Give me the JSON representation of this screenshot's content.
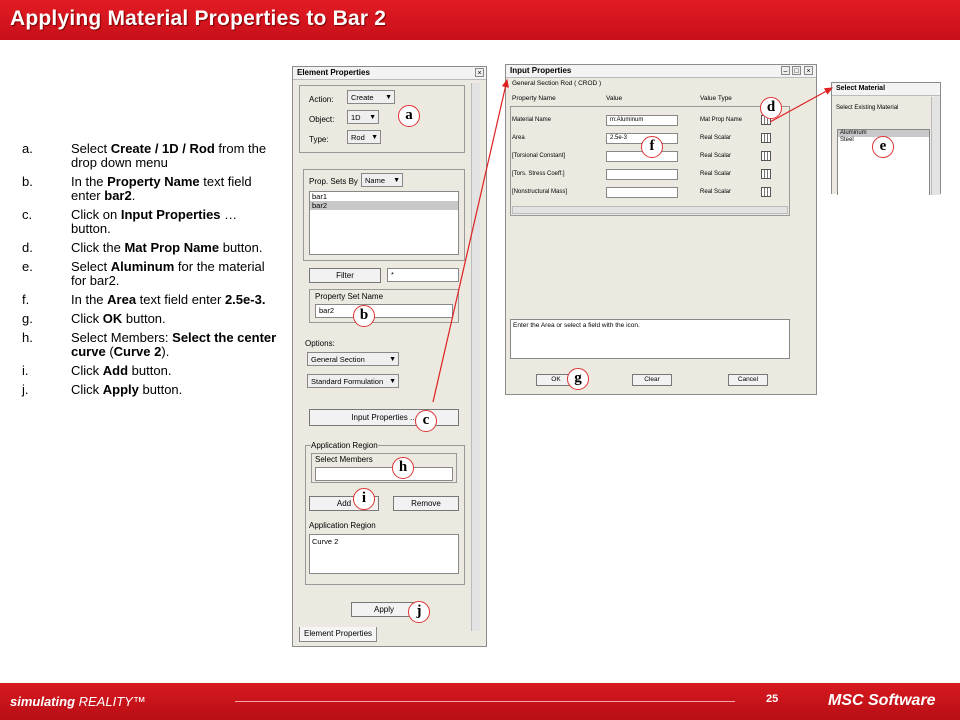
{
  "header": {
    "title": "Applying Material Properties to Bar 2"
  },
  "steps": [
    {
      "letter": "a.",
      "parts": [
        [
          "Select ",
          false
        ],
        [
          "Create / 1D / Rod",
          true
        ],
        [
          " from the drop down menu",
          false
        ]
      ]
    },
    {
      "letter": "b.",
      "parts": [
        [
          "In the ",
          false
        ],
        [
          "Property Name",
          true
        ],
        [
          " text field enter ",
          false
        ],
        [
          "bar2",
          true
        ],
        [
          ".",
          false
        ]
      ]
    },
    {
      "letter": "c.",
      "parts": [
        [
          "Click on ",
          false
        ],
        [
          "Input Properties",
          true
        ],
        [
          " … button.",
          false
        ]
      ]
    },
    {
      "letter": "d.",
      "parts": [
        [
          "Click the ",
          false
        ],
        [
          "Mat Prop Name",
          true
        ],
        [
          " button.",
          false
        ]
      ]
    },
    {
      "letter": "e.",
      "parts": [
        [
          "Select ",
          false
        ],
        [
          "Aluminum",
          true
        ],
        [
          " for the material for bar2.",
          false
        ]
      ]
    },
    {
      "letter": "f.",
      "parts": [
        [
          "In the ",
          false
        ],
        [
          "Area",
          true
        ],
        [
          " text field enter ",
          false
        ],
        [
          "2.5e-3.",
          true
        ]
      ]
    },
    {
      "letter": "g.",
      "parts": [
        [
          "Click ",
          false
        ],
        [
          "OK",
          true
        ],
        [
          " button.",
          false
        ]
      ]
    },
    {
      "letter": "h.",
      "parts": [
        [
          "Select Members: ",
          false
        ],
        [
          "Select the center curve",
          true
        ],
        [
          " (",
          false
        ],
        [
          "Curve 2",
          true
        ],
        [
          ").",
          false
        ]
      ]
    },
    {
      "letter": "i.",
      "parts": [
        [
          "Click ",
          false
        ],
        [
          "Add",
          true
        ],
        [
          " button.",
          false
        ]
      ]
    },
    {
      "letter": "j.",
      "parts": [
        [
          "Click ",
          false
        ],
        [
          "Apply",
          true
        ],
        [
          " button.",
          false
        ]
      ]
    }
  ],
  "element_properties": {
    "title": "Element Properties",
    "action_label": "Action:",
    "action_value": "Create",
    "object_label": "Object:",
    "object_value": "1D",
    "type_label": "Type:",
    "type_value": "Rod",
    "prop_sets_by_label": "Prop. Sets By",
    "prop_sets_by_value": "Name",
    "prop_sets": [
      "bar1",
      "bar2"
    ],
    "filter_button": "Filter",
    "filter_value": "*",
    "property_set_name_label": "Property Set Name",
    "property_set_name_value": "bar2",
    "options_label": "Options:",
    "option1": "General Section",
    "option2": "Standard Formulation",
    "input_properties_button": "Input Properties ...",
    "application_region_label": "Application Region",
    "select_members_label": "Select Members",
    "add_button": "Add",
    "remove_button": "Remove",
    "application_region_list_label": "Application Region",
    "application_region_items": [
      "Curve 2"
    ],
    "apply_button": "Apply",
    "tab_label": "Element Properties"
  },
  "input_properties": {
    "title": "Input Properties",
    "subtitle": "General Section Rod ( CROD )",
    "col_name": "Property Name",
    "col_value": "Value",
    "col_type": "Value Type",
    "rows": [
      {
        "name": "Material Name",
        "value": "m:Aluminum",
        "type": "Mat Prop Name"
      },
      {
        "name": "Area",
        "value": "2.5e-3",
        "type": "Real Scalar"
      },
      {
        "name": "[Torsional Constant]",
        "value": "",
        "type": "Real Scalar"
      },
      {
        "name": "[Tors. Stress Coeff.]",
        "value": "",
        "type": "Real Scalar"
      },
      {
        "name": "[Nonstructural Mass]",
        "value": "",
        "type": "Real Scalar"
      }
    ],
    "message": "Enter the Area or select a field with the icon.",
    "ok_button": "OK",
    "clear_button": "Clear",
    "cancel_button": "Cancel"
  },
  "select_material": {
    "title": "Select Material",
    "label": "Select Existing Material",
    "items": [
      "Aluminum",
      "Steel"
    ]
  },
  "callouts": {
    "a": "a",
    "b": "b",
    "c": "c",
    "d": "d",
    "e": "e",
    "f": "f",
    "g": "g",
    "h": "h",
    "i": "i",
    "j": "j"
  },
  "footer": {
    "brand_bold": "simulating",
    "brand_rest": " REALITY™",
    "page": "25",
    "logo": "MSC Software"
  },
  "colors": {
    "header_red": "#e31b23",
    "callout_arrow": "#e02020"
  }
}
